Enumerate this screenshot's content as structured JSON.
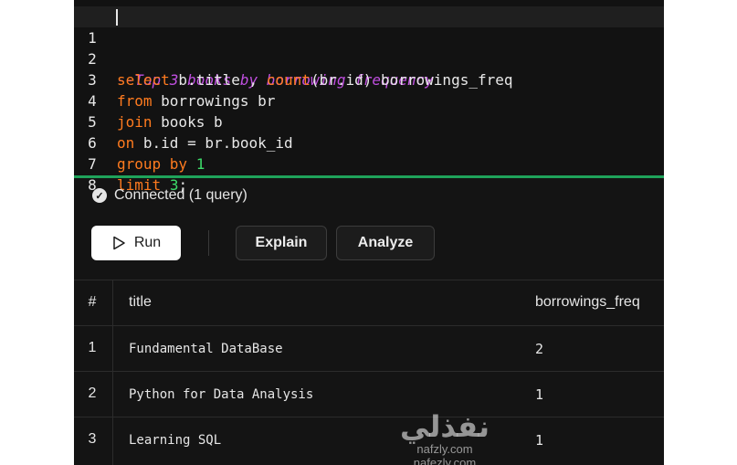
{
  "editor": {
    "lines": [
      {
        "num": "1",
        "parts": [
          {
            "t": "--Top 3 books by borrowing frequency",
            "c": "cm"
          }
        ]
      },
      {
        "num": "2",
        "parts": [
          {
            "t": "select",
            "c": "kw"
          },
          {
            "t": " b.title , ",
            "c": ""
          },
          {
            "t": "count",
            "c": "fn"
          },
          {
            "t": "(br.id) borrowings_freq",
            "c": ""
          }
        ]
      },
      {
        "num": "3",
        "parts": [
          {
            "t": "from",
            "c": "kw"
          },
          {
            "t": " borrowings br",
            "c": ""
          }
        ]
      },
      {
        "num": "4",
        "parts": [
          {
            "t": "join",
            "c": "kw"
          },
          {
            "t": " books b",
            "c": ""
          }
        ]
      },
      {
        "num": "5",
        "parts": [
          {
            "t": "on",
            "c": "kw"
          },
          {
            "t": " b.id = br.book_id",
            "c": ""
          }
        ]
      },
      {
        "num": "6",
        "parts": [
          {
            "t": "group by",
            "c": "kw"
          },
          {
            "t": " ",
            "c": ""
          },
          {
            "t": "1",
            "c": "num"
          }
        ]
      },
      {
        "num": "7",
        "parts": [
          {
            "t": "limit",
            "c": "kw"
          },
          {
            "t": " ",
            "c": ""
          },
          {
            "t": "3",
            "c": "num"
          },
          {
            "t": ";",
            "c": ""
          }
        ]
      },
      {
        "num": "8",
        "parts": []
      }
    ]
  },
  "status": {
    "text": "Connected (1 query)",
    "icon": "check-circle-icon"
  },
  "toolbar": {
    "run_label": "Run",
    "explain_label": "Explain",
    "analyze_label": "Analyze"
  },
  "results": {
    "columns": [
      "#",
      "title",
      "borrowings_freq"
    ],
    "rows": [
      {
        "num": "1",
        "title": "Fundamental DataBase",
        "freq": "2"
      },
      {
        "num": "2",
        "title": "Python for Data Analysis",
        "freq": "1"
      },
      {
        "num": "3",
        "title": "Learning SQL",
        "freq": "1"
      }
    ]
  },
  "watermark": {
    "arabic": "نفذلي",
    "latin_1": "nafzly.com",
    "latin_2": "nafezly.com"
  }
}
